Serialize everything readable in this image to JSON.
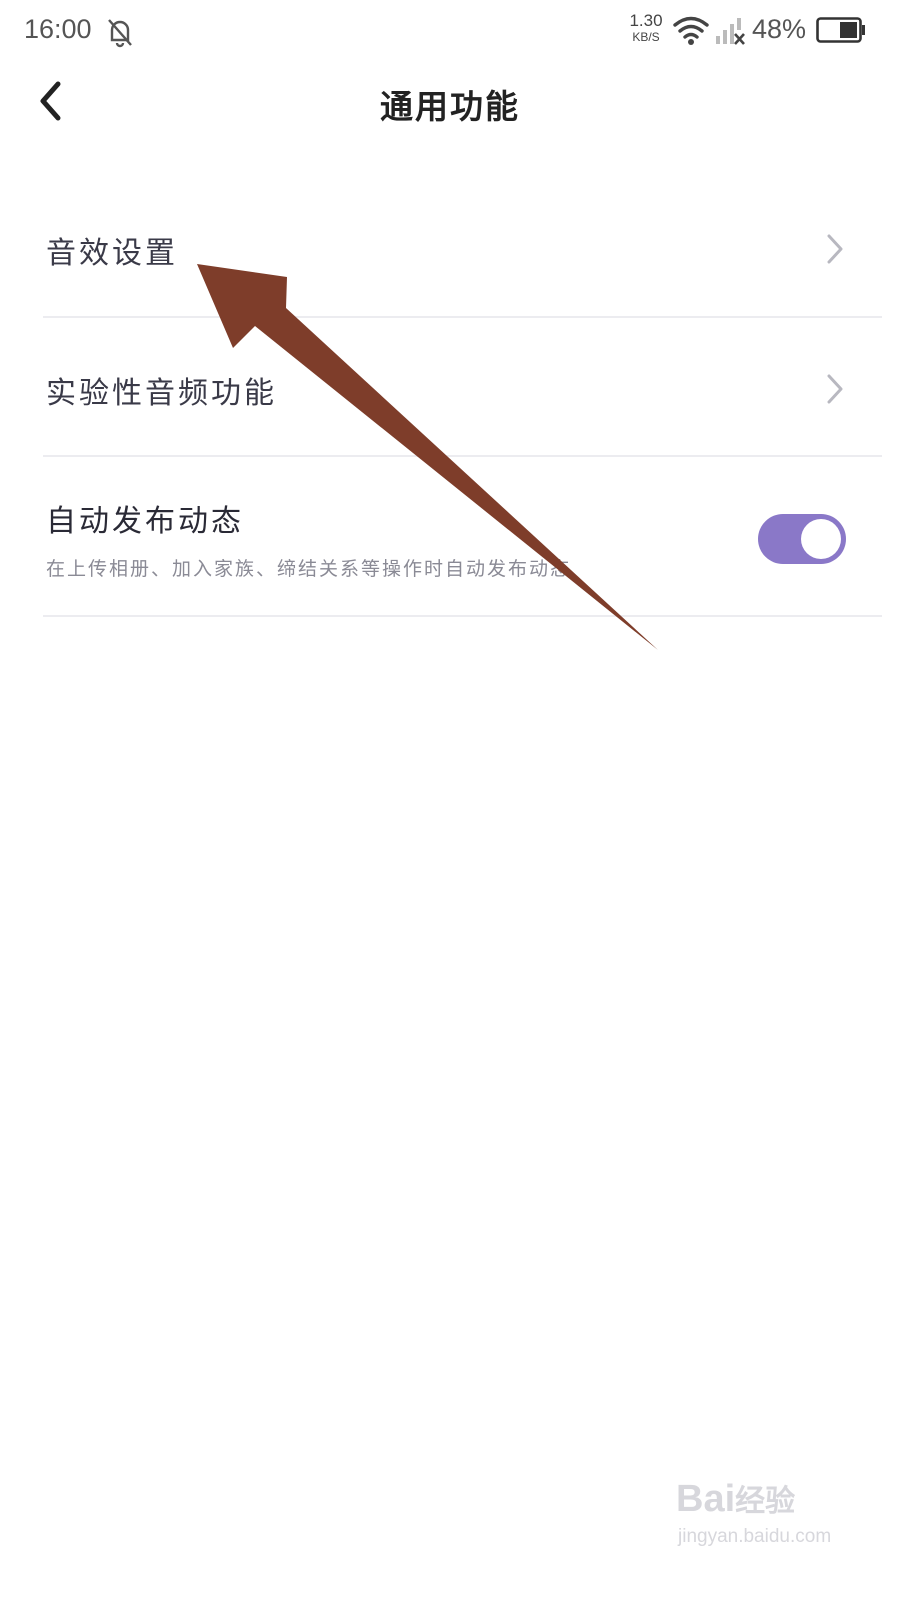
{
  "status_bar": {
    "time": "16:00",
    "net_speed_value": "1.30",
    "net_speed_unit": "KB/S",
    "battery": "48%",
    "icons": [
      "bell-off-icon",
      "wifi-icon",
      "signal-no-service-icon",
      "battery-icon"
    ]
  },
  "header": {
    "title": "通用功能",
    "back_icon": "chevron-left-icon"
  },
  "settings": [
    {
      "label": "音效设置",
      "action": "chevron-right-icon"
    },
    {
      "label": "实验性音频功能",
      "action": "chevron-right-icon"
    },
    {
      "label": "自动发布动态",
      "description": "在上传相册、加入家族、缔结关系等操作时自动发布动态",
      "toggle_on": true
    }
  ],
  "colors": {
    "toggle_on": "#8a78c8",
    "annotation_arrow": "#7e3d2a",
    "divider": "#ececf0"
  },
  "watermark": {
    "logo_text": "Bai",
    "logo_sub": "经验",
    "url": "jingyan.baidu.com"
  }
}
